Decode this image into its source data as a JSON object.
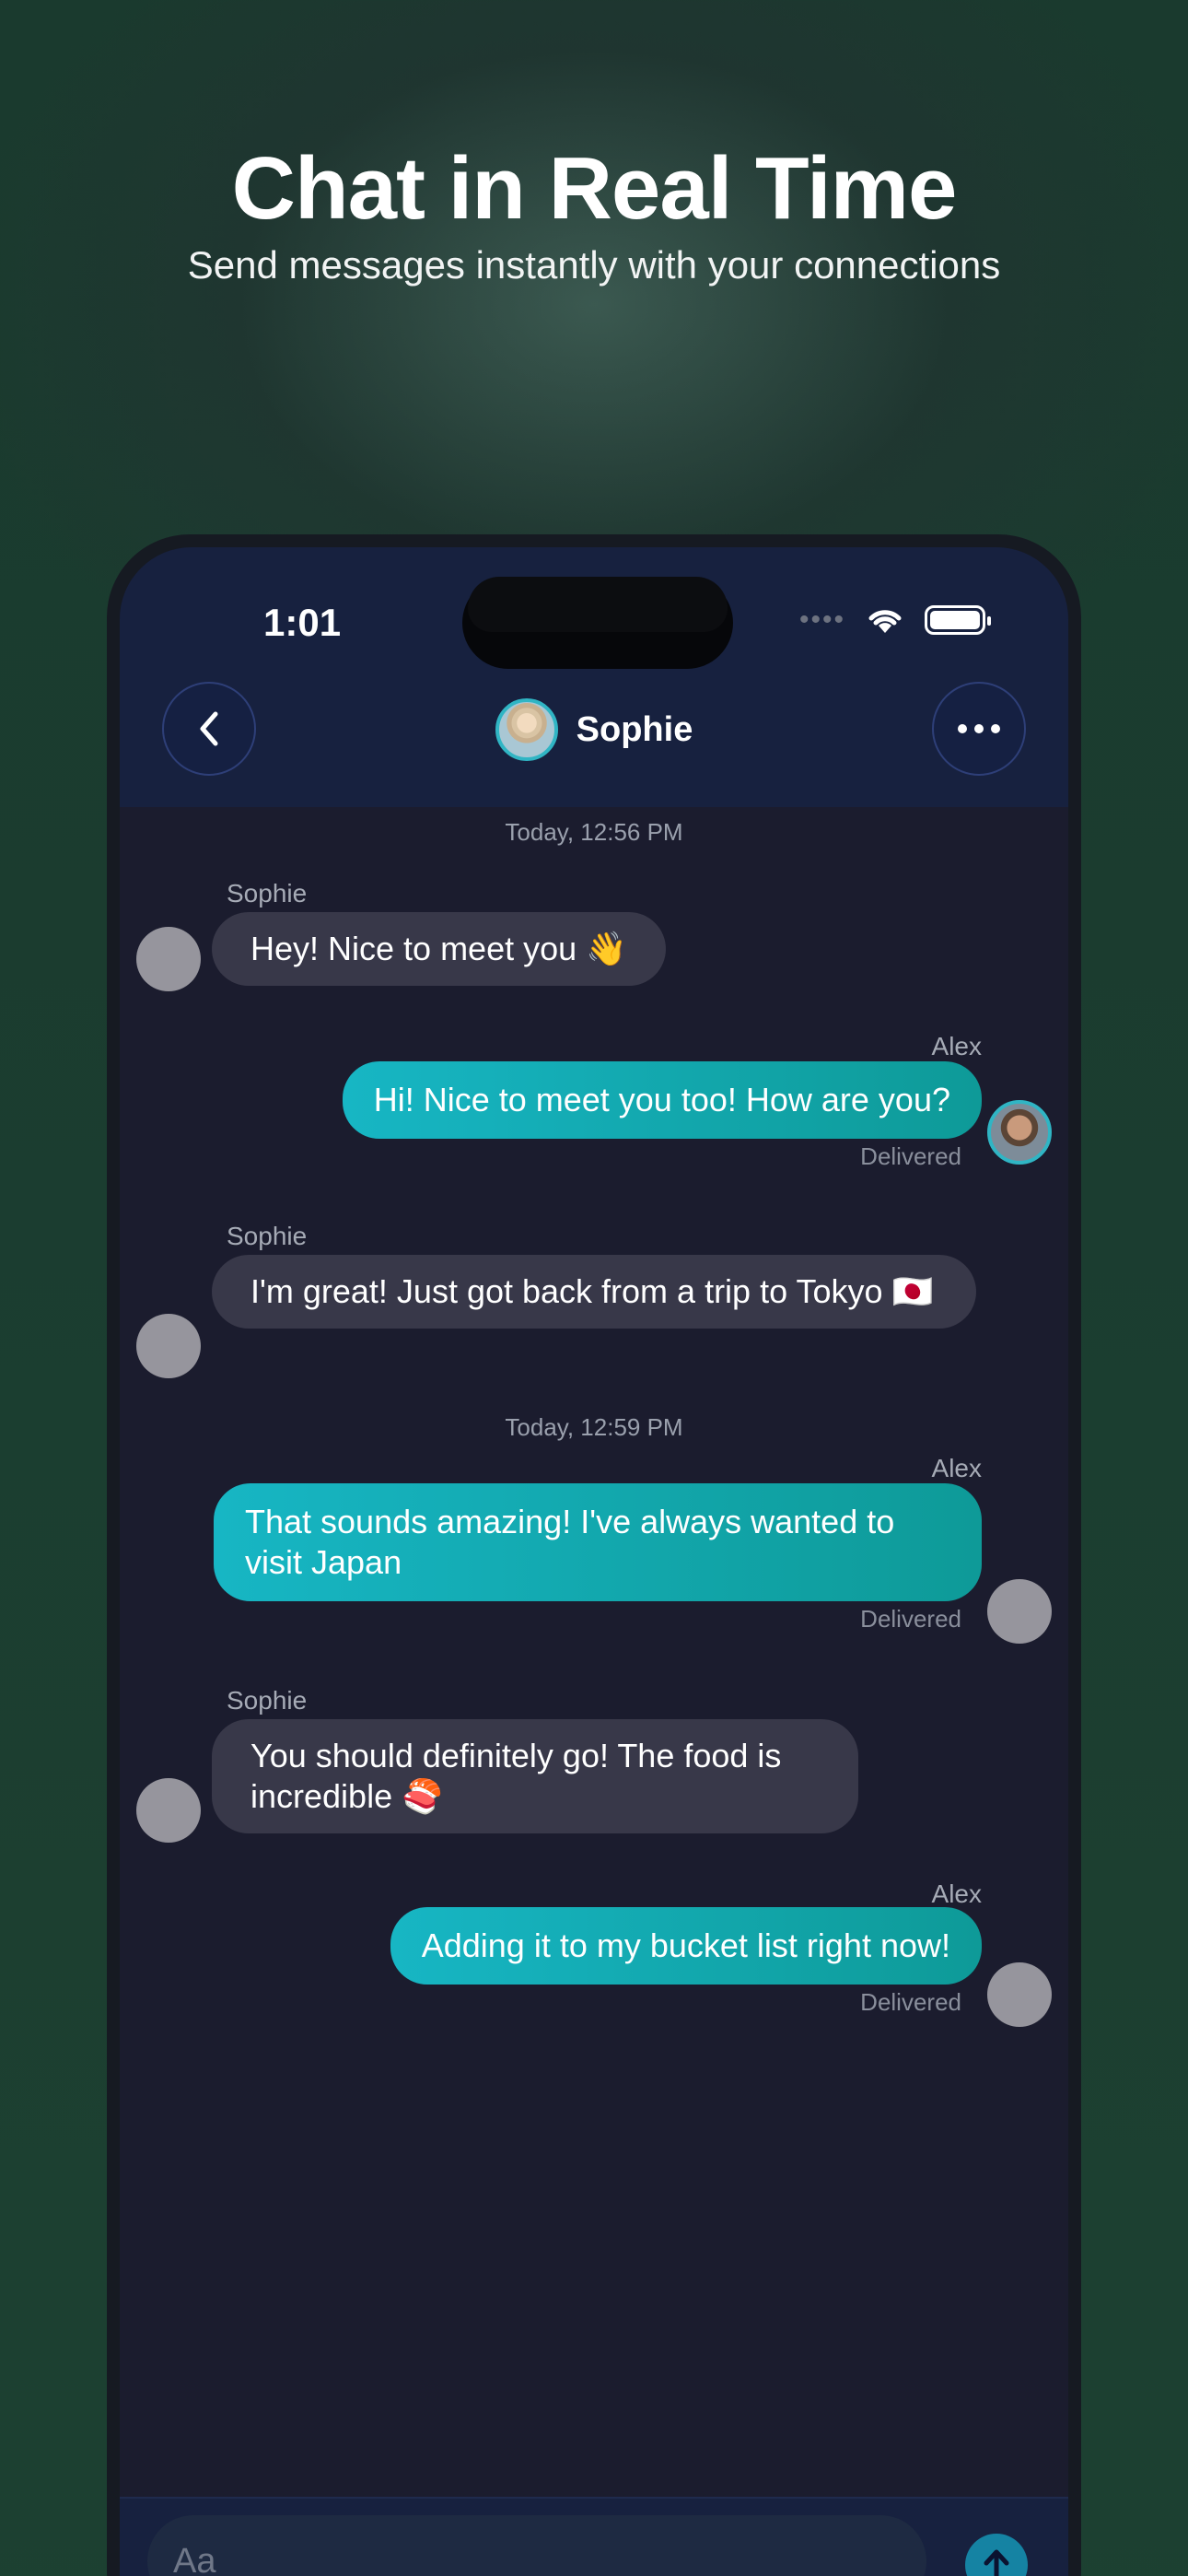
{
  "hero": {
    "title": "Chat in Real Time",
    "subtitle": "Send messages instantly with your connections"
  },
  "status_bar": {
    "time": "1:01"
  },
  "chat_header": {
    "contact_name": "Sophie"
  },
  "messages": [
    {
      "type": "date",
      "text": "Today, 12:56 PM"
    },
    {
      "type": "incoming",
      "sender": "Sophie",
      "text": "Hey! Nice to meet you 👋"
    },
    {
      "type": "outgoing",
      "sender": "Alex",
      "text": "Hi! Nice to meet you too! How are you?",
      "status": "Delivered"
    },
    {
      "type": "incoming",
      "sender": "Sophie",
      "text": "I'm great! Just got back from a trip to Tokyo 🇯🇵"
    },
    {
      "type": "date",
      "text": "Today, 12:59 PM"
    },
    {
      "type": "outgoing",
      "sender": "Alex",
      "text": "That sounds amazing! I've always wanted to visit Japan",
      "status": "Delivered"
    },
    {
      "type": "incoming",
      "sender": "Sophie",
      "text": "You should definitely go! The food is incredible 🍣"
    },
    {
      "type": "outgoing",
      "sender": "Alex",
      "text": "Adding it to my bucket list right now!",
      "status": "Delivered"
    }
  ],
  "composer": {
    "placeholder": "Aa"
  },
  "colors": {
    "outgoing_bubble": "#17b6c4",
    "incoming_bubble": "#383849",
    "header_bg": "#17213f",
    "chat_bg": "#1b1c2e"
  },
  "icons": [
    "back-chevron-icon",
    "more-dots-icon",
    "wifi-icon",
    "battery-icon",
    "send-arrow-icon"
  ]
}
